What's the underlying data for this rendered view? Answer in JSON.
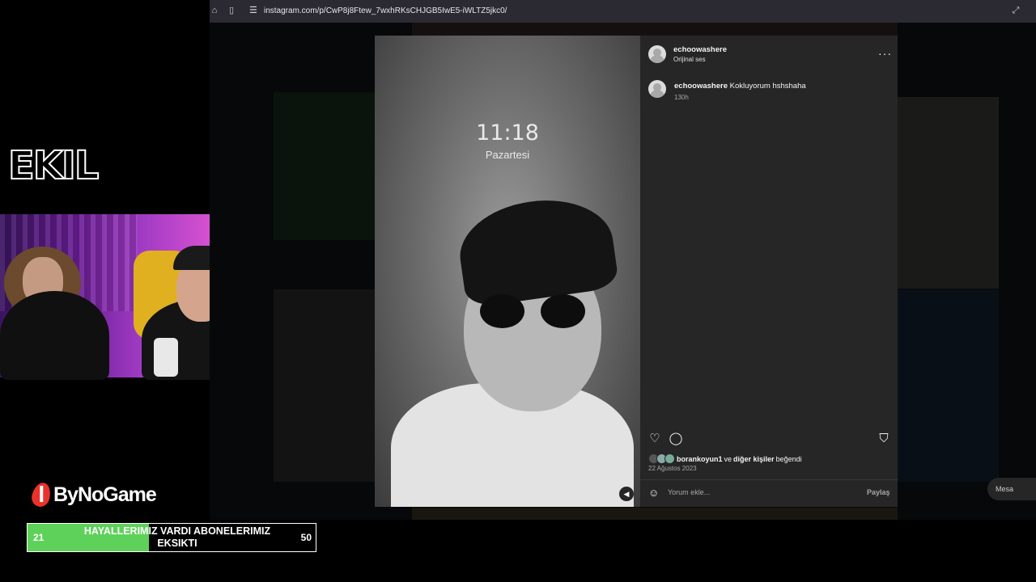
{
  "overlay": {
    "channel_logo": "EKIL",
    "sponsor": "ByNoGame",
    "goal": {
      "current": "21",
      "target": "50",
      "text": "HAYALLERIMIZ VARDI ABONELERIMIZ EKSIKTI",
      "progress": 0.42
    }
  },
  "browser": {
    "url": "instagram.com/p/CwP8j8Ftew_7wxhRKsCHJGB5IwE5-iWLTZ5jkc0/"
  },
  "post": {
    "lockscreen_time": "11:18",
    "lockscreen_day": "Pazartesi",
    "author": "echoowashere",
    "audio": "Orijinal ses",
    "comment": {
      "user": "echoowashere",
      "text": "Kokluyorum hshshaha",
      "age": "130h"
    },
    "likes": {
      "user": "borankoyun1",
      "connector": "ve",
      "others": "diğer kişiler",
      "suffix": "beğendi"
    },
    "date": "22 Ağustos 2023",
    "comment_placeholder": "Yorum ekle...",
    "share_label": "Paylaş",
    "messages_label": "Mesa"
  },
  "colors": {
    "panel_bg": "#262626",
    "goal_fill": "#5ed15a",
    "sponsor_red": "#e8322b",
    "webcam_accent": "#d34fd0"
  }
}
